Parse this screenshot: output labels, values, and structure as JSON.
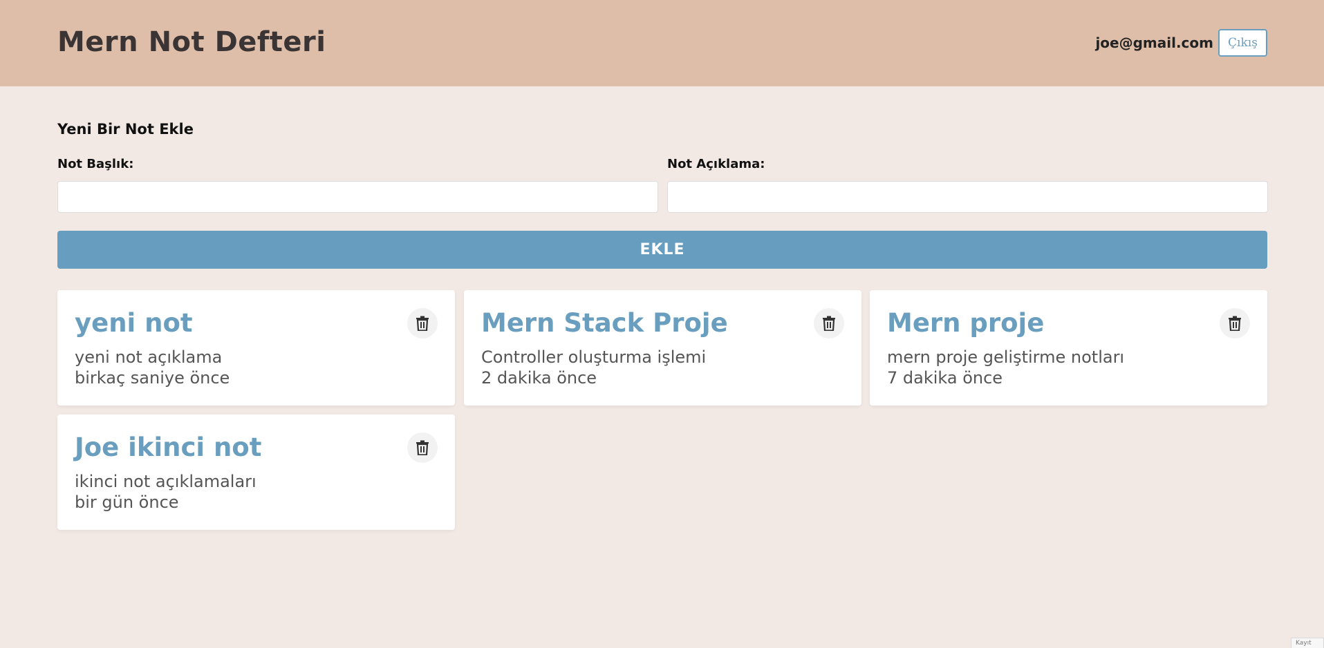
{
  "header": {
    "title": "Mern Not Defteri",
    "user_email": "joe@gmail.com",
    "logout_label": "Çıkış"
  },
  "form": {
    "heading": "Yeni Bir Not Ekle",
    "title_label": "Not Başlık:",
    "title_value": "",
    "description_label": "Not Açıklama:",
    "description_value": "",
    "submit_label": "EKLE"
  },
  "notes": [
    {
      "title": "yeni not",
      "description": "yeni not açıklama",
      "time": "birkaç saniye önce"
    },
    {
      "title": "Mern Stack Proje",
      "description": "Controller oluşturma işlemi",
      "time": "2 dakika önce"
    },
    {
      "title": "Mern proje",
      "description": "mern proje geliştirme notları",
      "time": "7 dakika önce"
    },
    {
      "title": "Joe ikinci not",
      "description": "ikinci not açıklamaları",
      "time": "bir gün önce"
    }
  ],
  "icons": {
    "delete": "trash-icon"
  },
  "colors": {
    "header_bg": "#dfbea9",
    "page_bg": "#f2e9e5",
    "accent": "#679dbf",
    "card_bg": "#ffffff"
  },
  "corner_tab_label": "Kayıt"
}
